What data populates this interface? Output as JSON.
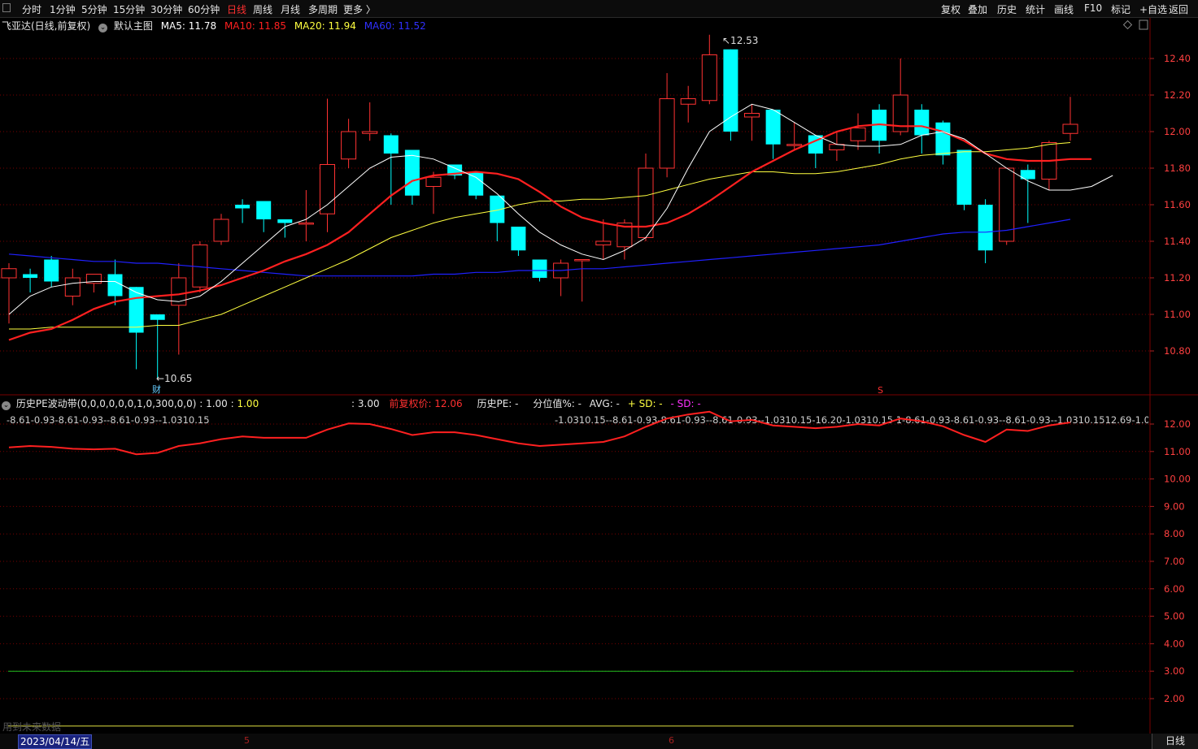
{
  "toolbar": {
    "left": [
      "分时",
      "1分钟",
      "5分钟",
      "15分钟",
      "30分钟",
      "60分钟",
      "日线",
      "周线",
      "月线",
      "多周期",
      "更多 〉"
    ],
    "active": "日线",
    "right": [
      "复权",
      "叠加",
      "历史",
      "统计",
      "画线",
      "F10",
      "标记",
      "+自选",
      "返回"
    ]
  },
  "main_legend": {
    "stock": "飞亚达(日线,前复权)",
    "template": "默认主图",
    "ma5": "MA5: 11.78",
    "ma10": "MA10: 11.85",
    "ma20": "MA20: 11.94",
    "ma60": "MA60: 11.52"
  },
  "colors": {
    "up": "#ff3232",
    "down": "#00ffff",
    "ma5": "#ffffff",
    "ma10": "#ff2020",
    "ma20": "#ffff40",
    "ma60": "#2020ff",
    "grid": "#7a0000"
  },
  "price_axis": [
    "12.40",
    "12.20",
    "12.00",
    "11.80",
    "11.60",
    "11.40",
    "11.20",
    "11.00",
    "10.80"
  ],
  "annotations": {
    "high": "12.53",
    "low": "10.65",
    "fin_marker": "财",
    "s_marker": "S"
  },
  "candles": [
    [
      11.2,
      11.28,
      10.95,
      11.25
    ],
    [
      11.22,
      11.25,
      11.12,
      11.2
    ],
    [
      11.3,
      11.32,
      11.15,
      11.18
    ],
    [
      11.1,
      11.25,
      11.05,
      11.2
    ],
    [
      11.17,
      11.22,
      11.12,
      11.22
    ],
    [
      11.22,
      11.3,
      11.05,
      11.1
    ],
    [
      11.15,
      11.15,
      10.7,
      10.9
    ],
    [
      11.0,
      11.0,
      10.65,
      10.97
    ],
    [
      11.05,
      11.28,
      10.78,
      11.2
    ],
    [
      11.15,
      11.4,
      11.12,
      11.38
    ],
    [
      11.4,
      11.55,
      11.38,
      11.52
    ],
    [
      11.6,
      11.63,
      11.5,
      11.58
    ],
    [
      11.62,
      11.62,
      11.45,
      11.52
    ],
    [
      11.52,
      11.52,
      11.42,
      11.5
    ],
    [
      11.5,
      11.68,
      11.4,
      11.5
    ],
    [
      11.55,
      12.18,
      11.45,
      11.82
    ],
    [
      11.85,
      12.07,
      11.8,
      12.0
    ],
    [
      11.99,
      12.16,
      11.95,
      12.0
    ],
    [
      11.98,
      11.99,
      11.6,
      11.88
    ],
    [
      11.9,
      11.9,
      11.6,
      11.65
    ],
    [
      11.7,
      11.78,
      11.55,
      11.75
    ],
    [
      11.82,
      11.82,
      11.74,
      11.76
    ],
    [
      11.78,
      11.78,
      11.63,
      11.65
    ],
    [
      11.65,
      11.65,
      11.4,
      11.5
    ],
    [
      11.48,
      11.48,
      11.32,
      11.35
    ],
    [
      11.3,
      11.3,
      11.18,
      11.2
    ],
    [
      11.2,
      11.3,
      11.1,
      11.28
    ],
    [
      11.3,
      11.3,
      11.07,
      11.3
    ],
    [
      11.38,
      11.52,
      11.3,
      11.4
    ],
    [
      11.37,
      11.52,
      11.3,
      11.5
    ],
    [
      11.42,
      11.88,
      11.4,
      11.8
    ],
    [
      11.8,
      12.32,
      11.75,
      12.18
    ],
    [
      12.15,
      12.25,
      12.05,
      12.18
    ],
    [
      12.17,
      12.53,
      12.15,
      12.42
    ],
    [
      12.45,
      12.45,
      11.95,
      12.0
    ],
    [
      12.08,
      12.15,
      11.95,
      12.1
    ],
    [
      12.12,
      12.12,
      11.85,
      11.93
    ],
    [
      11.93,
      12.05,
      11.9,
      11.93
    ],
    [
      11.98,
      11.98,
      11.8,
      11.88
    ],
    [
      11.9,
      12.0,
      11.84,
      11.93
    ],
    [
      11.95,
      12.1,
      11.9,
      12.02
    ],
    [
      12.12,
      12.15,
      11.88,
      11.95
    ],
    [
      12.0,
      12.4,
      11.98,
      12.2
    ],
    [
      12.12,
      12.15,
      11.88,
      11.98
    ],
    [
      12.05,
      12.06,
      11.82,
      11.87
    ],
    [
      11.9,
      11.9,
      11.57,
      11.6
    ],
    [
      11.6,
      11.63,
      11.28,
      11.35
    ],
    [
      11.4,
      11.8,
      11.38,
      11.8
    ],
    [
      11.79,
      11.82,
      11.5,
      11.74
    ],
    [
      11.74,
      11.95,
      11.68,
      11.94
    ],
    [
      11.99,
      12.19,
      11.95,
      12.04
    ]
  ],
  "ma_series": {
    "ma5": [
      11.0,
      11.1,
      11.15,
      11.17,
      11.18,
      11.18,
      11.12,
      11.08,
      11.07,
      11.1,
      11.18,
      11.28,
      11.38,
      11.48,
      11.52,
      11.6,
      11.7,
      11.8,
      11.86,
      11.87,
      11.85,
      11.8,
      11.75,
      11.66,
      11.55,
      11.45,
      11.38,
      11.33,
      11.3,
      11.35,
      11.42,
      11.58,
      11.8,
      12.0,
      12.08,
      12.15,
      12.12,
      12.05,
      11.98,
      11.93,
      11.92,
      11.92,
      11.93,
      11.98,
      12.0,
      11.96,
      11.88,
      11.8,
      11.73,
      11.68,
      11.68,
      11.7,
      11.76
    ],
    "ma10": [
      10.86,
      10.9,
      10.92,
      10.97,
      11.03,
      11.07,
      11.09,
      11.1,
      11.11,
      11.13,
      11.16,
      11.2,
      11.24,
      11.29,
      11.33,
      11.38,
      11.45,
      11.55,
      11.65,
      11.73,
      11.76,
      11.77,
      11.78,
      11.77,
      11.74,
      11.67,
      11.59,
      11.53,
      11.5,
      11.48,
      11.48,
      11.5,
      11.55,
      11.62,
      11.7,
      11.78,
      11.84,
      11.9,
      11.95,
      12.0,
      12.03,
      12.04,
      12.03,
      12.03,
      12.0,
      11.95,
      11.88,
      11.85,
      11.84,
      11.84,
      11.85,
      11.85
    ],
    "ma20": [
      10.92,
      10.92,
      10.93,
      10.93,
      10.93,
      10.93,
      10.93,
      10.94,
      10.94,
      10.97,
      11.0,
      11.05,
      11.1,
      11.15,
      11.2,
      11.25,
      11.3,
      11.36,
      11.42,
      11.46,
      11.5,
      11.53,
      11.55,
      11.57,
      11.6,
      11.62,
      11.62,
      11.63,
      11.63,
      11.64,
      11.65,
      11.68,
      11.71,
      11.74,
      11.76,
      11.78,
      11.78,
      11.77,
      11.77,
      11.78,
      11.8,
      11.82,
      11.85,
      11.87,
      11.88,
      11.89,
      11.89,
      11.9,
      11.91,
      11.93,
      11.94
    ],
    "ma60": [
      11.33,
      11.32,
      11.31,
      11.3,
      11.29,
      11.29,
      11.28,
      11.28,
      11.27,
      11.26,
      11.25,
      11.24,
      11.23,
      11.22,
      11.21,
      11.21,
      11.21,
      11.21,
      11.21,
      11.21,
      11.22,
      11.22,
      11.23,
      11.23,
      11.24,
      11.24,
      11.24,
      11.25,
      11.25,
      11.26,
      11.27,
      11.28,
      11.29,
      11.3,
      11.31,
      11.32,
      11.33,
      11.34,
      11.35,
      11.36,
      11.37,
      11.38,
      11.4,
      11.42,
      11.44,
      11.45,
      11.45,
      11.46,
      11.48,
      11.5,
      11.52
    ]
  },
  "sub_legend": {
    "name": "历史PE波动带(0,0,0,0,0,0,1,0,300,0,0) : 1.00 : ",
    "v1": "1.00",
    "v2": ": 3.00",
    "prev_price_label": "前复权价: 12.06",
    "pe_label": "历史PE: -",
    "pct_label": "分位值%: -",
    "avg_label": "AVG: -",
    "sd_plus": "+ SD: -",
    "sd_minus": "- SD: -"
  },
  "pe_text_left": "-8.61-0.93-8.61-0.93--8.61-0.93--1.0310.15",
  "pe_text_right": "-1.0310.15--8.61-0.93-8.61-0.93--8.61-0.93--1.0310.15-16.20-1.0310.15 1-8.61-0.93-8.61-0.93--8.61-0.93--1.0310.1512.69-1.0310.15-",
  "sub_axis": [
    "12.00",
    "11.00",
    "10.00",
    "9.00",
    "8.00",
    "7.00",
    "6.00",
    "5.00",
    "4.00",
    "3.00",
    "2.00"
  ],
  "sub_line": [
    11.15,
    11.2,
    11.17,
    11.1,
    11.08,
    11.1,
    10.9,
    10.95,
    11.2,
    11.3,
    11.45,
    11.55,
    11.5,
    11.5,
    11.5,
    11.8,
    12.02,
    12.0,
    11.82,
    11.6,
    11.7,
    11.7,
    11.6,
    11.45,
    11.3,
    11.2,
    11.25,
    11.3,
    11.35,
    11.55,
    11.9,
    12.2,
    12.35,
    12.45,
    12.1,
    12.15,
    11.95,
    11.9,
    11.85,
    11.9,
    12.0,
    11.95,
    12.2,
    12.1,
    11.92,
    11.6,
    11.35,
    11.8,
    11.75,
    11.95,
    12.06
  ],
  "footer": {
    "date": "2023/04/14/五",
    "month5": "5",
    "month6": "6",
    "tab": "日线",
    "future_hint": "用到未来数据"
  }
}
